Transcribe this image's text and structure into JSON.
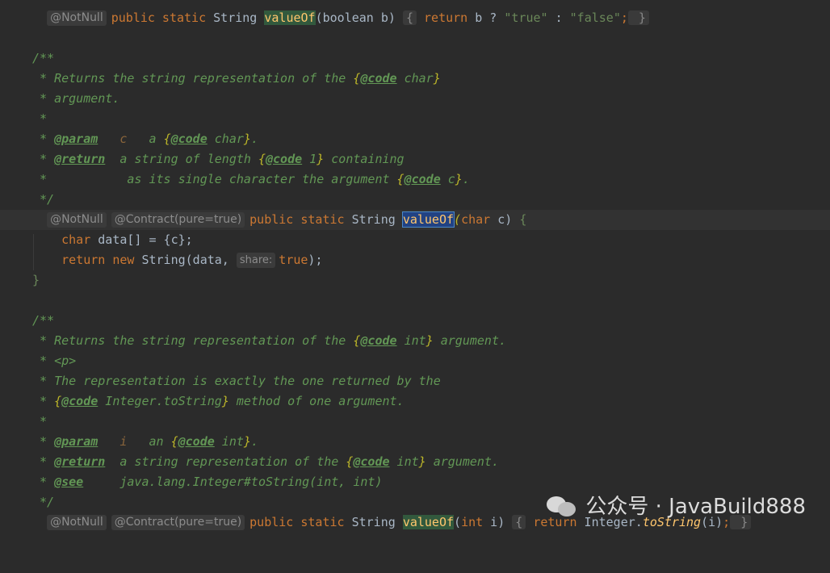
{
  "watermark": {
    "text": "公众号 · JavaBuild888",
    "icon": "wechat-icon"
  },
  "lines": {
    "l1": {
      "annot": "@NotNull",
      "kw1": "public static",
      "type": "String",
      "method": "valueOf",
      "params": "(boolean b) ",
      "ob": "{",
      "ret": " return",
      "body": " b ? ",
      "s1": "\"true\"",
      "mid": " : ",
      "s2": "\"false\"",
      "semi": ";",
      "cb": " }"
    },
    "l3": "/**",
    "l4": {
      "a": " * Returns the string representation of the ",
      "b": "{",
      "tag": "@code",
      "c": " char",
      "d": "}"
    },
    "l5": " * argument.",
    "l6": " *",
    "l7": {
      "a": " * ",
      "tag": "@param",
      "v": "   c",
      "b": "   a ",
      "br1": "{",
      "tag2": "@code",
      "c": " char",
      "br2": "}",
      "d": "."
    },
    "l8": {
      "a": " * ",
      "tag": "@return",
      "b": "  a string of length ",
      "br1": "{",
      "tag2": "@code",
      "c": " 1",
      "br2": "}",
      "d": " containing"
    },
    "l9": {
      "a": " *           as its single character the argument ",
      "br1": "{",
      "tag2": "@code",
      "c": " c",
      "br2": "}",
      "d": "."
    },
    "l10": " */",
    "l11": {
      "annot1": "@NotNull",
      "annot2": "@Contract(pure=true)",
      "kw1": "public static",
      "type": "String",
      "method": "valueOf",
      "p1": "(",
      "kw2": "char",
      "p2": " c) ",
      "ob": "{"
    },
    "l12": {
      "kw": "char",
      "body": " data[] = {c};"
    },
    "l13": {
      "kw1": "return",
      "kw2": " new",
      "body": " String(data, ",
      "hint": "share:",
      "kw3": "true",
      "end": ");"
    },
    "l14": "}",
    "l16": "/**",
    "l17": {
      "a": " * Returns the string representation of the ",
      "b": "{",
      "tag": "@code",
      "c": " int",
      "d": "}",
      "e": " argument."
    },
    "l18": " * <p>",
    "l19": " * The representation is exactly the one returned by the",
    "l20": {
      "a": " * ",
      "b": "{",
      "tag": "@code",
      "c": " Integer.toString",
      "d": "}",
      "e": " method of one argument."
    },
    "l21": " *",
    "l22": {
      "a": " * ",
      "tag": "@param",
      "v": "   i",
      "b": "   an ",
      "br1": "{",
      "tag2": "@code",
      "c": " int",
      "br2": "}",
      "d": "."
    },
    "l23": {
      "a": " * ",
      "tag": "@return",
      "b": "  a string representation of the ",
      "br1": "{",
      "tag2": "@code",
      "c": " int",
      "br2": "}",
      "d": " argument."
    },
    "l24": {
      "a": " * ",
      "tag": "@see",
      "b": "     java.lang.Integer#toString(int, int)"
    },
    "l25": " */",
    "l26": {
      "annot1": "@NotNull",
      "annot2": "@Contract(pure=true)",
      "kw1": "public static",
      "type": "String",
      "method": "valueOf",
      "p1": "(",
      "kw2": "int",
      "p2": " i) ",
      "ob": "{",
      "ret": " return",
      "cls": " Integer.",
      "sm": "toString",
      "args": "(i)",
      "semi": ";",
      "cb": " }"
    }
  }
}
